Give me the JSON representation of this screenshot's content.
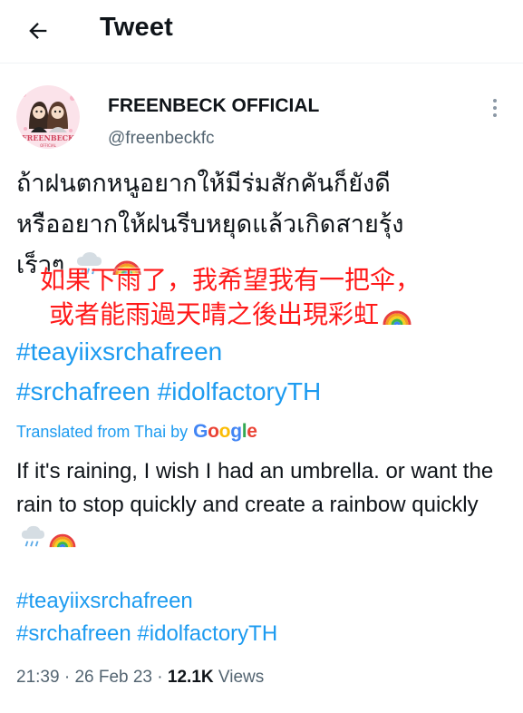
{
  "header": {
    "title": "Tweet"
  },
  "author": {
    "name": "FREENBECK OFFICIAL",
    "handle": "@freenbeckfc",
    "avatar_text": "FREENBECK",
    "avatar_subtext": "OFFICIAL"
  },
  "tweet": {
    "thai_line1": "ถ้าฝนตกหนูอยากให้มีร่มสักคันก็ยังดี",
    "thai_line2": "หรืออยากให้ฝนรีบหยุดแล้วเกิดสายรุ้ง",
    "thai_line3": "เร็วๆ",
    "overlay_line1": "如果下雨了，我希望我有一把伞，",
    "overlay_line2": "或者能雨過天晴之後出現彩虹",
    "hashtag1": "#teayiixsrchafreen",
    "hashtag2": "#srchafreen",
    "hashtag3": "#idolfactoryTH"
  },
  "translation": {
    "label": "Translated from Thai by",
    "provider": "Google",
    "text": "If it's raining, I wish I had an umbrella. or want the rain to stop quickly and create a rainbow quickly",
    "hashtag1": "#teayiixsrchafreen",
    "hashtag2": "#srchafreen",
    "hashtag3": "#idolfactoryTH"
  },
  "meta": {
    "time": "21:39",
    "date": "26 Feb 23",
    "views_count": "12.1K",
    "views_label": "Views",
    "separator": "·"
  },
  "icons": {
    "back": "arrow-left-icon",
    "more": "more-vertical-icon",
    "rain": "rain-cloud-icon",
    "rainbow": "rainbow-icon"
  },
  "colors": {
    "link": "#1d9bf0",
    "secondary_text": "#536471",
    "overlay_red": "#ff1a1a"
  }
}
